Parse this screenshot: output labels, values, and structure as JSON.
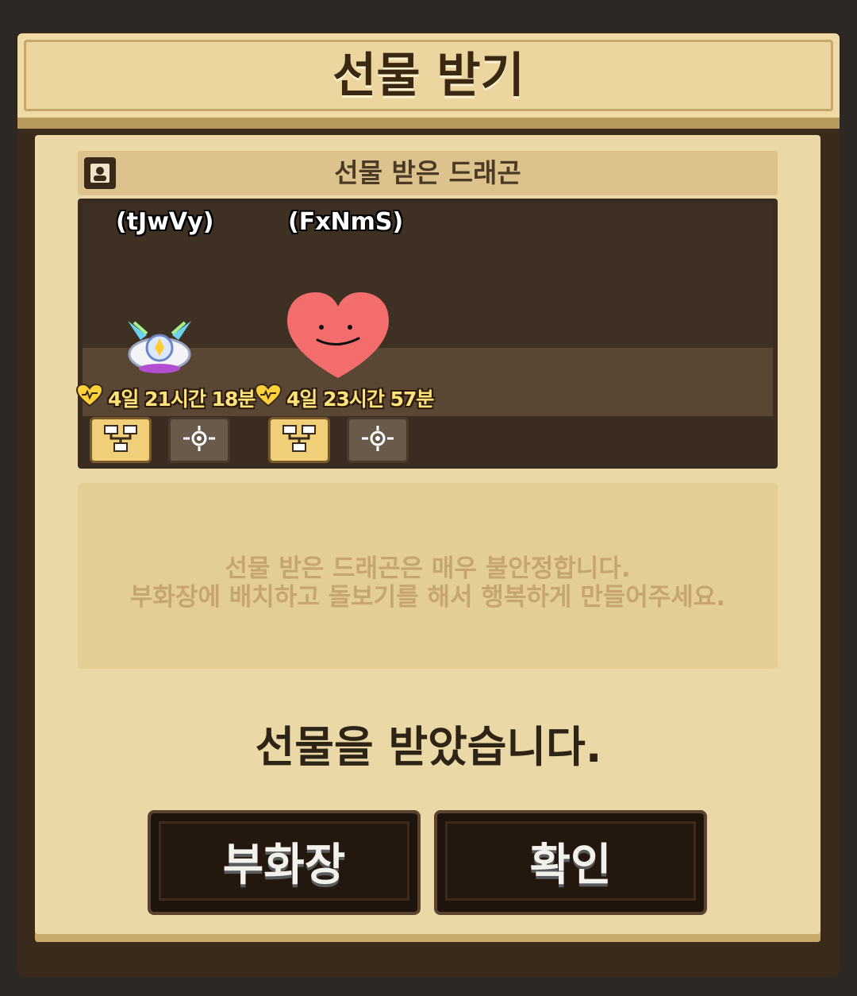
{
  "dialog": {
    "title": "선물 받기"
  },
  "section": {
    "title": "선물 받은 드래곤"
  },
  "dragons": [
    {
      "name": "(tJwVy)",
      "timer": "4일 21시간 18분"
    },
    {
      "name": "(FxNmS)",
      "timer": "4일 23시간 57분"
    }
  ],
  "message": {
    "line1": "선물 받은 드래곤은 매우 불안정합니다.",
    "line2": "부화장에 배치하고 돌보기를 해서 행복하게 만들어주세요."
  },
  "status": "선물을 받았습니다.",
  "buttons": {
    "hatchery": "부화장",
    "confirm": "확인"
  },
  "icons": {
    "profile": "profile-icon",
    "heart": "heart-icon",
    "tree": "tree-icon",
    "target": "target-icon"
  },
  "colors": {
    "timer": "#ffe27a",
    "accent": "#f1cf78"
  }
}
